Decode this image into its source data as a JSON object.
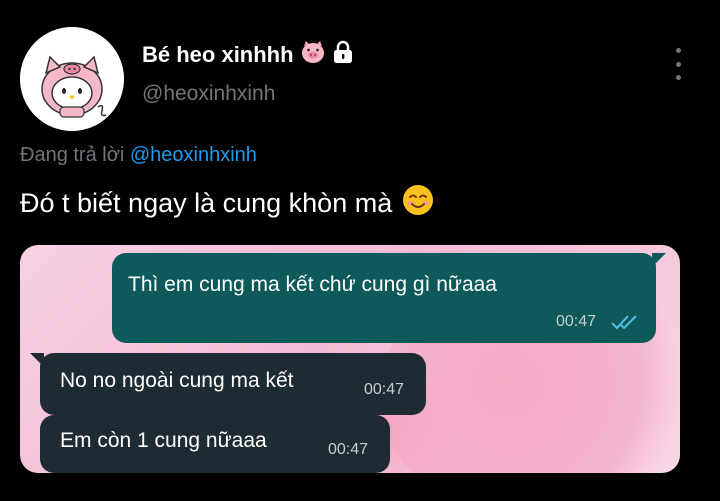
{
  "tweet": {
    "display_name": "Bé heo xinhhh",
    "name_emoji": "🐷",
    "lock_icon": "lock-icon",
    "handle": "@heoxinhxinh",
    "reply_prefix": "Đang trả lời",
    "reply_mention": "@heoxinhxinh",
    "text": "Đó t biết ngay là cung khòn mà",
    "text_emoji": "☺️"
  },
  "chat_image": {
    "messages": [
      {
        "direction": "outgoing",
        "text": "Thì em cung ma kết chứ cung gì nữaaa",
        "time": "00:47",
        "read_icon": "double-check-icon"
      },
      {
        "direction": "incoming",
        "text": "No no ngoài cung ma kết",
        "time": "00:47"
      },
      {
        "direction": "incoming",
        "text": "Em còn 1 cung nữaaa",
        "time": "00:47"
      }
    ]
  },
  "colors": {
    "background": "#000000",
    "mention": "#1d9bf0",
    "secondary_text": "#71767b",
    "outgoing_bubble": "#0e5a5a",
    "incoming_bubble": "#1f2b33",
    "read_check": "#53bdeb"
  }
}
